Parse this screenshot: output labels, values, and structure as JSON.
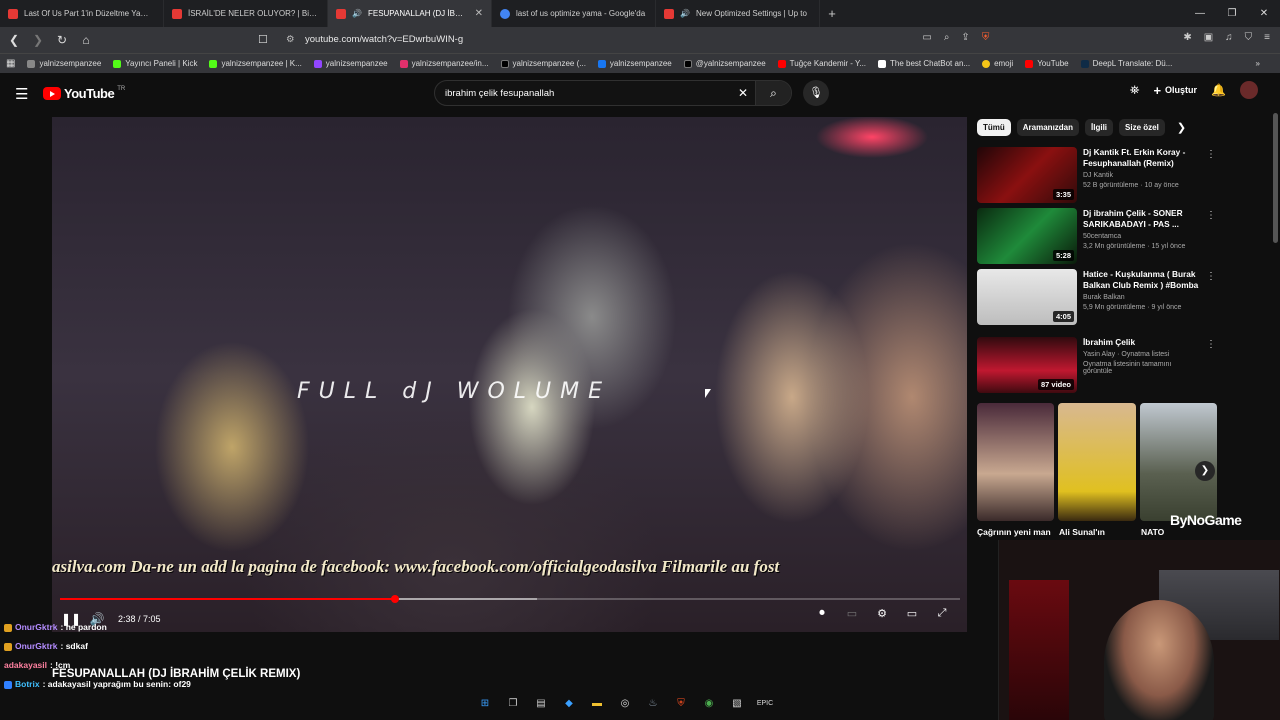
{
  "browser": {
    "tabs": [
      {
        "title": "Last Of Us Part 1'in Düzeltme Yamas",
        "icon": "youtube-icon",
        "active": false
      },
      {
        "title": "İSRAİL'DE NELER OLUYOR? | Binlerce",
        "icon": "youtube-icon",
        "active": false
      },
      {
        "title": "FESUPANALLAH (DJ İBRAHİM",
        "icon": "youtube-icon",
        "active": true
      },
      {
        "title": "last of us optimize yama - Google'da",
        "icon": "google-icon",
        "active": false
      },
      {
        "title": "New Optimized Settings | Up to",
        "icon": "youtube-icon",
        "active": false
      }
    ],
    "url": "youtube.com/watch?v=EDwrbuWIN-g",
    "bookmarks": [
      "yalnizsempanzee",
      "Yayıncı Paneli | Kick",
      "yalnizsempanzee | K...",
      "yalnizsempanzee",
      "yalnizsempanzee/in...",
      "yalnizsempanzee (...",
      "yalnizsempanzee",
      "@yalnizsempanzee",
      "Tuğçe Kandemir - Y...",
      "The best ChatBot an...",
      "emoji",
      "YouTube",
      "DeepL Translate: Dü..."
    ]
  },
  "youtube": {
    "logo": "YouTube",
    "region": "TR",
    "search_value": "ibrahim çelik fesupanallah",
    "create_label": "Oluştur"
  },
  "player": {
    "overlay_text": "FULL dJ WOLUME",
    "ticker": "asilva.com    Da-ne un add la pagina de facebook: www.facebook.com/officialgeodasilva    Filmarile au fost",
    "time": "2:38 / 7:05",
    "progress_fraction": 0.372,
    "loaded_fraction": 0.53
  },
  "video_title": "FESUPANALLAH (DJ İBRAHİM ÇELİK REMIX)",
  "sidebar": {
    "chips": [
      "Tümü",
      "Aramanızdan",
      "İlgili",
      "Size özel"
    ],
    "videos": [
      {
        "title": "Dj Kantik Ft. Erkin Koray - Fesuphanallah (Remix)",
        "channel": "DJ Kantik",
        "meta": "52 B görüntüleme · 10 ay önce",
        "duration": "3:35"
      },
      {
        "title": "Dj ibrahim Çelik - SONER SARIKABADAYI - PAS ...",
        "channel": "50centamca",
        "meta": "3,2 Mn görüntüleme · 15 yıl önce",
        "duration": "5:28"
      },
      {
        "title": "Hatice - Kuşkulanma ( Burak Balkan Club Remix ) #Bomba",
        "channel": "Burak Balkan",
        "meta": "5,9 Mn görüntüleme · 9 yıl önce",
        "duration": "4:05"
      },
      {
        "title": "İbrahim Çelik",
        "channel": "Yasin Alay · Oynatma listesi",
        "meta": "Oynatma listesinin tamamını görüntüle",
        "duration": "87 video"
      }
    ],
    "shorts_labels": [
      "Çağrının yeni man",
      "Ali Sunal'ın",
      "NATO"
    ]
  },
  "chat": [
    {
      "user": "OnurGktrk",
      "text": ": he pardon"
    },
    {
      "user": "OnurGktrk",
      "text": ": sdkaf"
    },
    {
      "user": "adakayasil",
      "text": ": !cm"
    },
    {
      "user": "Botrix",
      "text": ": adakayasil yaprağım bu senin: of29"
    }
  ],
  "overlay_brand": "ByNoGame",
  "colors": {
    "accent": "#ff0000",
    "background": "#0f0f0f"
  }
}
